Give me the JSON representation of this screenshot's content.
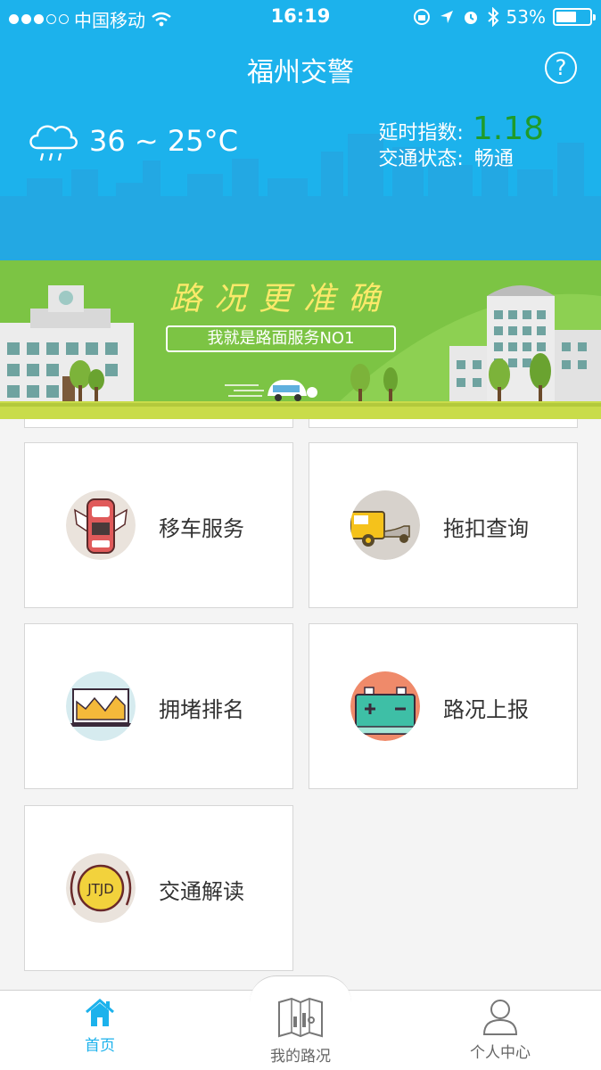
{
  "status_bar": {
    "carrier": "中国移动",
    "time": "16:19",
    "battery": "53%"
  },
  "header": {
    "title": "福州交警",
    "help_icon": "question-circle-icon"
  },
  "weather": {
    "icon": "cloud-rain-icon",
    "temperature": "36 ~ 25°C"
  },
  "traffic": {
    "delay_label": "延时指数:",
    "delay_value": "1.18",
    "status_label": "交通状态:",
    "status_value": "畅通"
  },
  "banner": {
    "slogan": "路况更准确",
    "subslogan": "我就是路面服务NO1"
  },
  "services": [
    {
      "label": "移车服务",
      "icon": "car-move-icon"
    },
    {
      "label": "拖扣查询",
      "icon": "tow-truck-icon"
    },
    {
      "label": "拥堵排名",
      "icon": "chart-monitor-icon"
    },
    {
      "label": "路况上报",
      "icon": "battery-report-icon"
    },
    {
      "label": "交通解读",
      "icon": "jtjd-badge-icon",
      "badge_text": "JTJD"
    }
  ],
  "tabs": [
    {
      "label": "首页",
      "icon": "home-icon",
      "active": true
    },
    {
      "label": "我的路况",
      "icon": "map-icon",
      "active": false
    },
    {
      "label": "个人中心",
      "icon": "user-icon",
      "active": false
    }
  ],
  "colors": {
    "brand_blue": "#1cb2ec",
    "delay_green": "#1f9b2a",
    "banner_green": "#7cc444",
    "slogan_yellow": "#fbe96a"
  }
}
